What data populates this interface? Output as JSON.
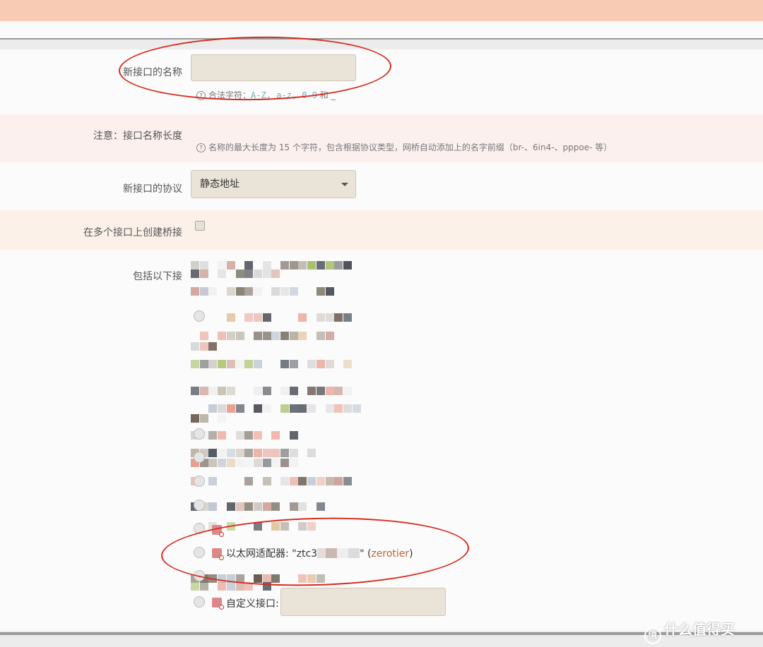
{
  "form": {
    "name_label": "新接口的名称",
    "name_value": "",
    "name_hint_prefix": "合法字符：",
    "name_hint_chars": "A-Z, a-z, 0-9",
    "name_hint_suffix": " 和 _",
    "note_label": "注意：接口名称长度",
    "note_hint": "名称的最大长度为 15 个字符，包含根据协议类型，网桥自动添加上的名字前缀（br-、6in4-、pppoe- 等）",
    "protocol_label": "新接口的协议",
    "protocol_value": "静态地址",
    "bridge_label": "在多个接口上创建桥接",
    "include_label": "包括以下接"
  },
  "interfaces": {
    "zerotier_label": "以太网适配器: \"ztc3",
    "zerotier_suffix": "\" (",
    "zerotier_name": "zerotier",
    "zerotier_close": ")",
    "custom_label": "自定义接口:"
  },
  "watermark": {
    "badge": "值",
    "text": "什么值得买"
  },
  "colors": {
    "annotation": "#d42a1e",
    "accent": "#c0622a",
    "top_bar": "#f8cbb4"
  }
}
